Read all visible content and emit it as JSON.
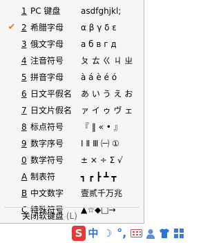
{
  "menu": {
    "items": [
      {
        "num": "1",
        "label": "PC 键盘",
        "preview": "asdfghjkl;",
        "checked": false
      },
      {
        "num": "2",
        "label": "希腊字母",
        "preview": "α β γ δ ε",
        "checked": true
      },
      {
        "num": "3",
        "label": "俄文字母",
        "preview": "а б в г д",
        "checked": false
      },
      {
        "num": "4",
        "label": "注音符号",
        "preview": "ㄆ ㄊ ㄍ ㄐ ㄓ",
        "checked": false
      },
      {
        "num": "5",
        "label": "拼音字母",
        "preview": "à á è é ó",
        "checked": false
      },
      {
        "num": "6",
        "label": "日文平假名",
        "preview": "あ い う え お",
        "checked": false
      },
      {
        "num": "7",
        "label": "日文片假名",
        "preview": "ァ イ ゥ ヴ ェ",
        "checked": false
      },
      {
        "num": "8",
        "label": "标点符号",
        "preview": "『 ‖ « • 』",
        "checked": false
      },
      {
        "num": "9",
        "label": "数字序号",
        "preview": "Ⅰ Ⅱ Ⅲ ㈠ ①",
        "checked": false
      },
      {
        "num": "0",
        "label": "数学符号",
        "preview": "± × ÷ Σ √",
        "checked": false
      },
      {
        "num": "A",
        "label": "制表符",
        "preview": "┓ ┏ ┣ ┻ ┳",
        "checked": false
      },
      {
        "num": "B",
        "label": "中文数字",
        "preview": "壹贰千万兆",
        "checked": false
      },
      {
        "num": "C",
        "label": "特殊符号",
        "preview": "▲☆◆□→",
        "checked": false
      }
    ],
    "close_label": "关闭软键盘",
    "close_shortcut": "(L)"
  },
  "tray": {
    "logo": "S",
    "mode": "中",
    "moon": "☽",
    "punct": "°,",
    "accent": "#e07b22"
  }
}
